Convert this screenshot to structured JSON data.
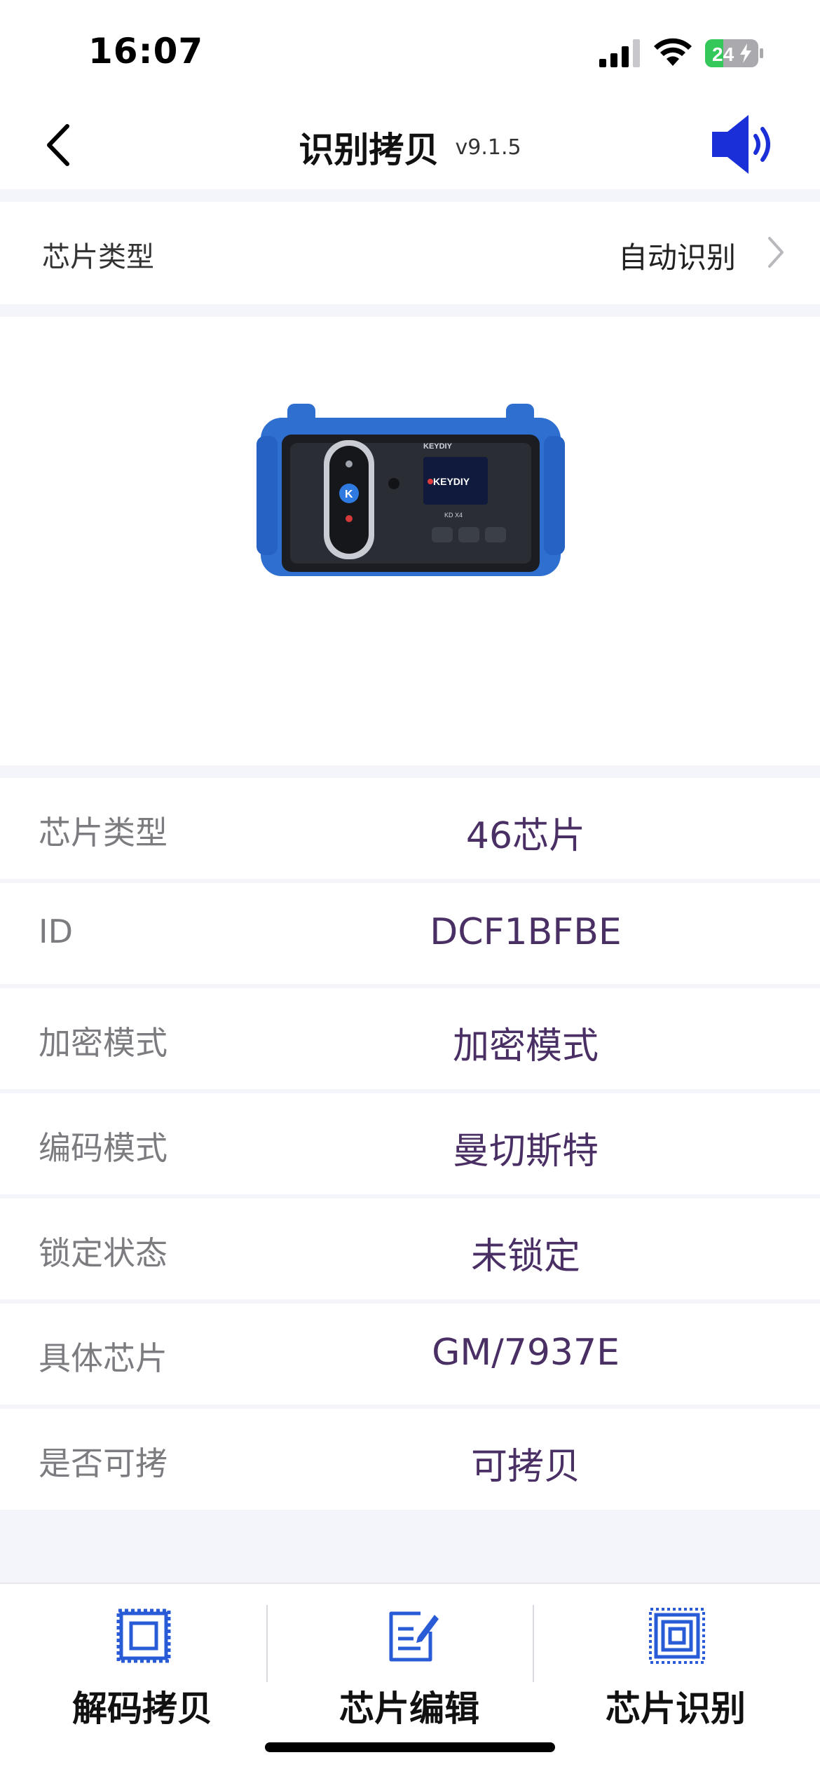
{
  "status_bar": {
    "time": "16:07",
    "battery": "24"
  },
  "header": {
    "title": "识别拷贝",
    "version": "v9.1.5"
  },
  "chip_selector": {
    "label": "芯片类型",
    "value": "自动识别"
  },
  "device": {
    "brand": "KEYDIY",
    "model": "KD X4"
  },
  "info_rows": [
    {
      "label": "芯片类型",
      "value": "46芯片"
    },
    {
      "label": "ID",
      "value": "DCF1BFBE"
    },
    {
      "label": "加密模式",
      "value": "加密模式"
    },
    {
      "label": "编码模式",
      "value": "曼切斯特"
    },
    {
      "label": "锁定状态",
      "value": "未锁定"
    },
    {
      "label": "具体芯片",
      "value": "GM/7937E"
    },
    {
      "label": "是否可拷",
      "value": "可拷贝"
    }
  ],
  "tabs": [
    {
      "label": "解码拷贝",
      "icon": "chip-decode-icon"
    },
    {
      "label": "芯片编辑",
      "icon": "edit-icon"
    },
    {
      "label": "芯片识别",
      "icon": "chip-identify-icon"
    }
  ],
  "colors": {
    "accent_blue": "#2a5bd7",
    "value_purple": "#4a2f65",
    "battery_green": "#34c759"
  }
}
